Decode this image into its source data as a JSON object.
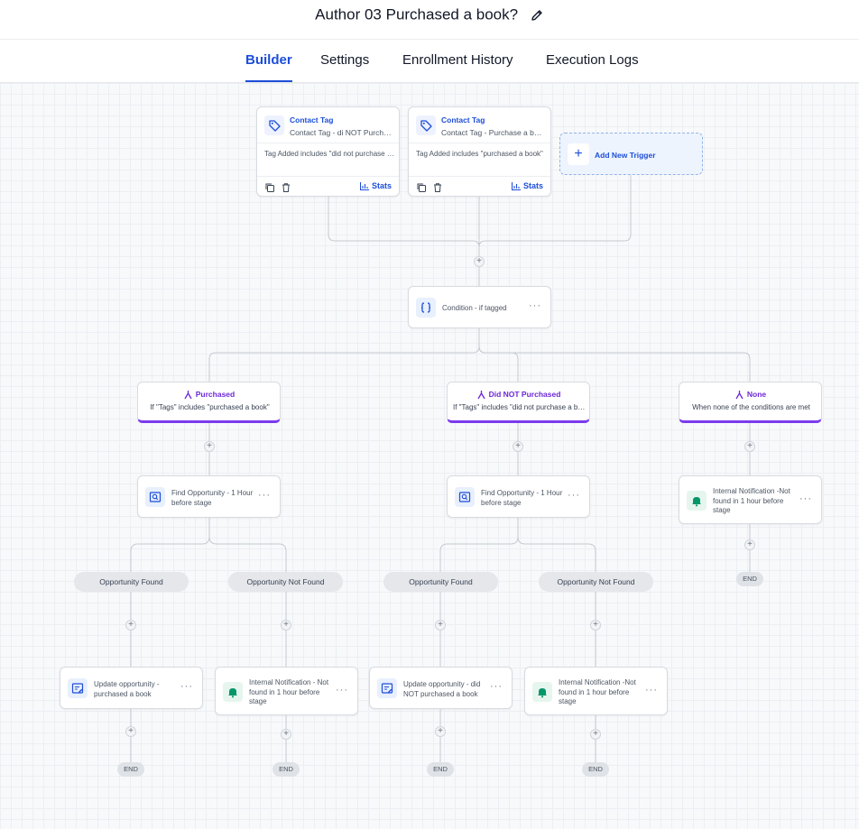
{
  "workflow": {
    "title": "Author 03 Purchased a book?"
  },
  "tabs": [
    {
      "label": "Builder",
      "active": true
    },
    {
      "label": "Settings",
      "active": false
    },
    {
      "label": "Enrollment History",
      "active": false
    },
    {
      "label": "Execution Logs",
      "active": false
    }
  ],
  "triggers": [
    {
      "type": "Contact Tag",
      "name": "Contact Tag - di NOT Purchased a book",
      "description": "Tag Added includes \"did not purchase a book\"",
      "stats_label": "Stats"
    },
    {
      "type": "Contact Tag",
      "name": "Contact Tag - Purchase a book",
      "description": "Tag Added includes \"purchased a book\"",
      "stats_label": "Stats"
    }
  ],
  "add_trigger_label": "Add New Trigger",
  "condition": {
    "label": "Condition - if tagged"
  },
  "branches": [
    {
      "name": "Purchased",
      "description": "If \"Tags\" includes \"purchased a book\""
    },
    {
      "name": "Did NOT Purchased",
      "description": "If \"Tags\" includes \"did not purchase a book\""
    },
    {
      "name": "None",
      "description": "When none of the conditions are met"
    }
  ],
  "actions": {
    "find_opportunity": "Find Opportunity - 1 Hour before stage",
    "internal_notification_none": "Internal Notification -Not found in 1 hour before stage",
    "update_purchased": "Update opportunity - purchased a book",
    "notification_not_found_1": "Internal Notification - Not found in 1 hour before stage",
    "update_not_purchased": "Update opportunity - did NOT purchased a book",
    "notification_not_found_2": "Internal Notification -Not found in 1 hour before stage"
  },
  "pills": {
    "found": "Opportunity Found",
    "not_found": "Opportunity Not Found"
  },
  "end_label": "END",
  "add_step_symbol": "+",
  "more_symbol": "···",
  "colors": {
    "accent": "#1d4ed8",
    "branch": "#7c3aed",
    "notification": "#059669"
  }
}
